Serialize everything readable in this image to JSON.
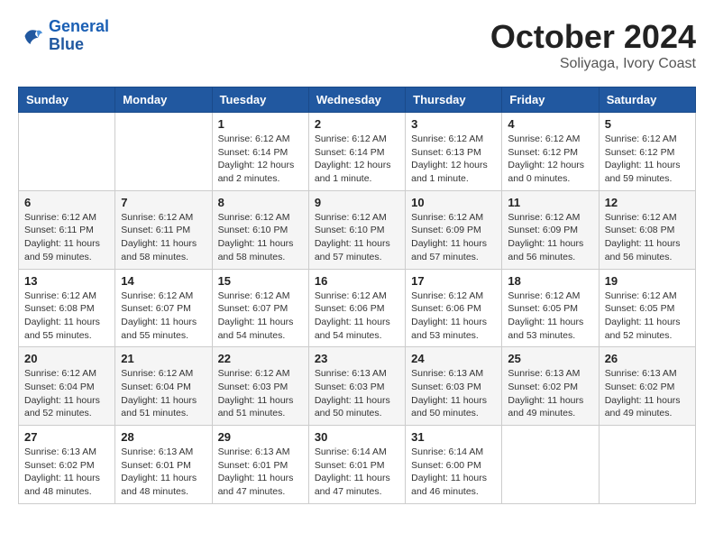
{
  "logo": {
    "text_general": "General",
    "text_blue": "Blue"
  },
  "header": {
    "month": "October 2024",
    "location": "Soliyaga, Ivory Coast"
  },
  "weekdays": [
    "Sunday",
    "Monday",
    "Tuesday",
    "Wednesday",
    "Thursday",
    "Friday",
    "Saturday"
  ],
  "weeks": [
    [
      {
        "day": "",
        "info": ""
      },
      {
        "day": "",
        "info": ""
      },
      {
        "day": "1",
        "info": "Sunrise: 6:12 AM\nSunset: 6:14 PM\nDaylight: 12 hours\nand 2 minutes."
      },
      {
        "day": "2",
        "info": "Sunrise: 6:12 AM\nSunset: 6:14 PM\nDaylight: 12 hours\nand 1 minute."
      },
      {
        "day": "3",
        "info": "Sunrise: 6:12 AM\nSunset: 6:13 PM\nDaylight: 12 hours\nand 1 minute."
      },
      {
        "day": "4",
        "info": "Sunrise: 6:12 AM\nSunset: 6:12 PM\nDaylight: 12 hours\nand 0 minutes."
      },
      {
        "day": "5",
        "info": "Sunrise: 6:12 AM\nSunset: 6:12 PM\nDaylight: 11 hours\nand 59 minutes."
      }
    ],
    [
      {
        "day": "6",
        "info": "Sunrise: 6:12 AM\nSunset: 6:11 PM\nDaylight: 11 hours\nand 59 minutes."
      },
      {
        "day": "7",
        "info": "Sunrise: 6:12 AM\nSunset: 6:11 PM\nDaylight: 11 hours\nand 58 minutes."
      },
      {
        "day": "8",
        "info": "Sunrise: 6:12 AM\nSunset: 6:10 PM\nDaylight: 11 hours\nand 58 minutes."
      },
      {
        "day": "9",
        "info": "Sunrise: 6:12 AM\nSunset: 6:10 PM\nDaylight: 11 hours\nand 57 minutes."
      },
      {
        "day": "10",
        "info": "Sunrise: 6:12 AM\nSunset: 6:09 PM\nDaylight: 11 hours\nand 57 minutes."
      },
      {
        "day": "11",
        "info": "Sunrise: 6:12 AM\nSunset: 6:09 PM\nDaylight: 11 hours\nand 56 minutes."
      },
      {
        "day": "12",
        "info": "Sunrise: 6:12 AM\nSunset: 6:08 PM\nDaylight: 11 hours\nand 56 minutes."
      }
    ],
    [
      {
        "day": "13",
        "info": "Sunrise: 6:12 AM\nSunset: 6:08 PM\nDaylight: 11 hours\nand 55 minutes."
      },
      {
        "day": "14",
        "info": "Sunrise: 6:12 AM\nSunset: 6:07 PM\nDaylight: 11 hours\nand 55 minutes."
      },
      {
        "day": "15",
        "info": "Sunrise: 6:12 AM\nSunset: 6:07 PM\nDaylight: 11 hours\nand 54 minutes."
      },
      {
        "day": "16",
        "info": "Sunrise: 6:12 AM\nSunset: 6:06 PM\nDaylight: 11 hours\nand 54 minutes."
      },
      {
        "day": "17",
        "info": "Sunrise: 6:12 AM\nSunset: 6:06 PM\nDaylight: 11 hours\nand 53 minutes."
      },
      {
        "day": "18",
        "info": "Sunrise: 6:12 AM\nSunset: 6:05 PM\nDaylight: 11 hours\nand 53 minutes."
      },
      {
        "day": "19",
        "info": "Sunrise: 6:12 AM\nSunset: 6:05 PM\nDaylight: 11 hours\nand 52 minutes."
      }
    ],
    [
      {
        "day": "20",
        "info": "Sunrise: 6:12 AM\nSunset: 6:04 PM\nDaylight: 11 hours\nand 52 minutes."
      },
      {
        "day": "21",
        "info": "Sunrise: 6:12 AM\nSunset: 6:04 PM\nDaylight: 11 hours\nand 51 minutes."
      },
      {
        "day": "22",
        "info": "Sunrise: 6:12 AM\nSunset: 6:03 PM\nDaylight: 11 hours\nand 51 minutes."
      },
      {
        "day": "23",
        "info": "Sunrise: 6:13 AM\nSunset: 6:03 PM\nDaylight: 11 hours\nand 50 minutes."
      },
      {
        "day": "24",
        "info": "Sunrise: 6:13 AM\nSunset: 6:03 PM\nDaylight: 11 hours\nand 50 minutes."
      },
      {
        "day": "25",
        "info": "Sunrise: 6:13 AM\nSunset: 6:02 PM\nDaylight: 11 hours\nand 49 minutes."
      },
      {
        "day": "26",
        "info": "Sunrise: 6:13 AM\nSunset: 6:02 PM\nDaylight: 11 hours\nand 49 minutes."
      }
    ],
    [
      {
        "day": "27",
        "info": "Sunrise: 6:13 AM\nSunset: 6:02 PM\nDaylight: 11 hours\nand 48 minutes."
      },
      {
        "day": "28",
        "info": "Sunrise: 6:13 AM\nSunset: 6:01 PM\nDaylight: 11 hours\nand 48 minutes."
      },
      {
        "day": "29",
        "info": "Sunrise: 6:13 AM\nSunset: 6:01 PM\nDaylight: 11 hours\nand 47 minutes."
      },
      {
        "day": "30",
        "info": "Sunrise: 6:14 AM\nSunset: 6:01 PM\nDaylight: 11 hours\nand 47 minutes."
      },
      {
        "day": "31",
        "info": "Sunrise: 6:14 AM\nSunset: 6:00 PM\nDaylight: 11 hours\nand 46 minutes."
      },
      {
        "day": "",
        "info": ""
      },
      {
        "day": "",
        "info": ""
      }
    ]
  ]
}
